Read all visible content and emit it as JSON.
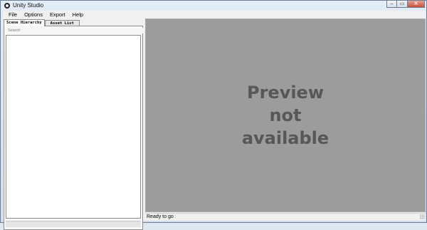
{
  "window": {
    "title": "Unity Studio"
  },
  "window_controls": {
    "minimize": "–",
    "maximize": "▭",
    "close": "✕"
  },
  "menu": [
    "File",
    "Options",
    "Export",
    "Help"
  ],
  "tabs": [
    {
      "label": "Scene Hierarchy",
      "active": true
    },
    {
      "label": "Asset List",
      "active": false
    }
  ],
  "search": {
    "placeholder": "Search"
  },
  "preview": {
    "line1": "Preview",
    "line2": "not",
    "line3": "available"
  },
  "status": {
    "text": "Ready to go"
  },
  "colors": {
    "preview_bg": "#9c9c9c",
    "preview_text": "#575757",
    "chrome": "#dfe7f1"
  },
  "icons": {
    "app": "unity-icon",
    "grip": "resize-grip-icon"
  }
}
